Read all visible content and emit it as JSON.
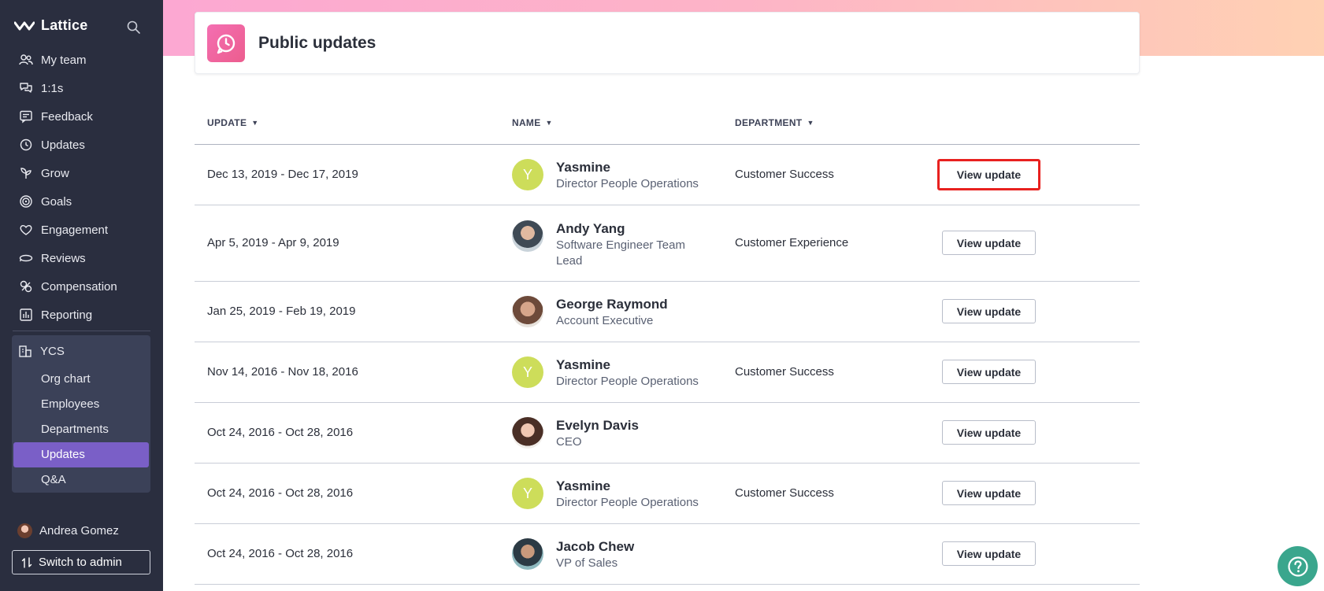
{
  "brand": {
    "name": "Lattice"
  },
  "sidebar": {
    "nav": [
      {
        "label": "My team",
        "icon": "people-icon"
      },
      {
        "label": "1:1s",
        "icon": "chat-bubbles-icon"
      },
      {
        "label": "Feedback",
        "icon": "feedback-icon"
      },
      {
        "label": "Updates",
        "icon": "updates-icon"
      },
      {
        "label": "Grow",
        "icon": "plant-icon"
      },
      {
        "label": "Goals",
        "icon": "target-icon"
      },
      {
        "label": "Engagement",
        "icon": "heart-icon"
      },
      {
        "label": "Reviews",
        "icon": "reviews-icon"
      },
      {
        "label": "Compensation",
        "icon": "compensation-icon"
      },
      {
        "label": "Reporting",
        "icon": "bar-chart-icon"
      }
    ],
    "group": {
      "label": "YCS",
      "icon": "building-icon",
      "items": [
        {
          "label": "Org chart"
        },
        {
          "label": "Employees"
        },
        {
          "label": "Departments"
        },
        {
          "label": "Updates",
          "active": true
        },
        {
          "label": "Q&A"
        }
      ]
    },
    "user": {
      "name": "Andrea Gomez"
    },
    "switch_label": "Switch to admin"
  },
  "page": {
    "title": "Public updates",
    "accent": "#f46fb2"
  },
  "table": {
    "headers": {
      "update": "UPDATE",
      "name": "NAME",
      "department": "DEPARTMENT"
    },
    "button_label": "View update",
    "rows": [
      {
        "dates": "Dec 13, 2019 - Dec 17, 2019",
        "name": "Yasmine",
        "title": "Director People Operations",
        "department": "Customer Success",
        "avatar": "Y"
      },
      {
        "dates": "Apr 5, 2019 - Apr 9, 2019",
        "name": "Andy Yang",
        "title": "Software Engineer Team Lead",
        "department": "Customer Experience",
        "avatar": ""
      },
      {
        "dates": "Jan 25, 2019 - Feb 19, 2019",
        "name": "George Raymond",
        "title": "Account Executive",
        "department": "",
        "avatar": ""
      },
      {
        "dates": "Nov 14, 2016 - Nov 18, 2016",
        "name": "Yasmine",
        "title": "Director People Operations",
        "department": "Customer Success",
        "avatar": "Y"
      },
      {
        "dates": "Oct 24, 2016 - Oct 28, 2016",
        "name": "Evelyn Davis",
        "title": "CEO",
        "department": "",
        "avatar": ""
      },
      {
        "dates": "Oct 24, 2016 - Oct 28, 2016",
        "name": "Yasmine",
        "title": "Director People Operations",
        "department": "Customer Success",
        "avatar": "Y"
      },
      {
        "dates": "Oct 24, 2016 - Oct 28, 2016",
        "name": "Jacob Chew",
        "title": "VP of Sales",
        "department": "",
        "avatar": ""
      }
    ]
  },
  "help": {
    "icon": "help-icon"
  }
}
